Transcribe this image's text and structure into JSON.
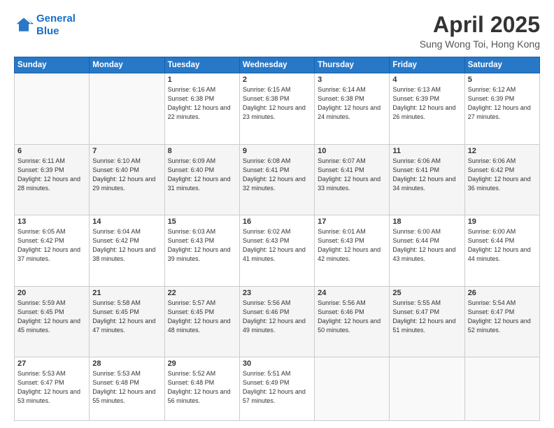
{
  "header": {
    "logo_line1": "General",
    "logo_line2": "Blue",
    "month": "April 2025",
    "location": "Sung Wong Toi, Hong Kong"
  },
  "weekdays": [
    "Sunday",
    "Monday",
    "Tuesday",
    "Wednesday",
    "Thursday",
    "Friday",
    "Saturday"
  ],
  "weeks": [
    [
      {
        "day": "",
        "sunrise": "",
        "sunset": "",
        "daylight": ""
      },
      {
        "day": "",
        "sunrise": "",
        "sunset": "",
        "daylight": ""
      },
      {
        "day": "1",
        "sunrise": "Sunrise: 6:16 AM",
        "sunset": "Sunset: 6:38 PM",
        "daylight": "Daylight: 12 hours and 22 minutes."
      },
      {
        "day": "2",
        "sunrise": "Sunrise: 6:15 AM",
        "sunset": "Sunset: 6:38 PM",
        "daylight": "Daylight: 12 hours and 23 minutes."
      },
      {
        "day": "3",
        "sunrise": "Sunrise: 6:14 AM",
        "sunset": "Sunset: 6:38 PM",
        "daylight": "Daylight: 12 hours and 24 minutes."
      },
      {
        "day": "4",
        "sunrise": "Sunrise: 6:13 AM",
        "sunset": "Sunset: 6:39 PM",
        "daylight": "Daylight: 12 hours and 26 minutes."
      },
      {
        "day": "5",
        "sunrise": "Sunrise: 6:12 AM",
        "sunset": "Sunset: 6:39 PM",
        "daylight": "Daylight: 12 hours and 27 minutes."
      }
    ],
    [
      {
        "day": "6",
        "sunrise": "Sunrise: 6:11 AM",
        "sunset": "Sunset: 6:39 PM",
        "daylight": "Daylight: 12 hours and 28 minutes."
      },
      {
        "day": "7",
        "sunrise": "Sunrise: 6:10 AM",
        "sunset": "Sunset: 6:40 PM",
        "daylight": "Daylight: 12 hours and 29 minutes."
      },
      {
        "day": "8",
        "sunrise": "Sunrise: 6:09 AM",
        "sunset": "Sunset: 6:40 PM",
        "daylight": "Daylight: 12 hours and 31 minutes."
      },
      {
        "day": "9",
        "sunrise": "Sunrise: 6:08 AM",
        "sunset": "Sunset: 6:41 PM",
        "daylight": "Daylight: 12 hours and 32 minutes."
      },
      {
        "day": "10",
        "sunrise": "Sunrise: 6:07 AM",
        "sunset": "Sunset: 6:41 PM",
        "daylight": "Daylight: 12 hours and 33 minutes."
      },
      {
        "day": "11",
        "sunrise": "Sunrise: 6:06 AM",
        "sunset": "Sunset: 6:41 PM",
        "daylight": "Daylight: 12 hours and 34 minutes."
      },
      {
        "day": "12",
        "sunrise": "Sunrise: 6:06 AM",
        "sunset": "Sunset: 6:42 PM",
        "daylight": "Daylight: 12 hours and 36 minutes."
      }
    ],
    [
      {
        "day": "13",
        "sunrise": "Sunrise: 6:05 AM",
        "sunset": "Sunset: 6:42 PM",
        "daylight": "Daylight: 12 hours and 37 minutes."
      },
      {
        "day": "14",
        "sunrise": "Sunrise: 6:04 AM",
        "sunset": "Sunset: 6:42 PM",
        "daylight": "Daylight: 12 hours and 38 minutes."
      },
      {
        "day": "15",
        "sunrise": "Sunrise: 6:03 AM",
        "sunset": "Sunset: 6:43 PM",
        "daylight": "Daylight: 12 hours and 39 minutes."
      },
      {
        "day": "16",
        "sunrise": "Sunrise: 6:02 AM",
        "sunset": "Sunset: 6:43 PM",
        "daylight": "Daylight: 12 hours and 41 minutes."
      },
      {
        "day": "17",
        "sunrise": "Sunrise: 6:01 AM",
        "sunset": "Sunset: 6:43 PM",
        "daylight": "Daylight: 12 hours and 42 minutes."
      },
      {
        "day": "18",
        "sunrise": "Sunrise: 6:00 AM",
        "sunset": "Sunset: 6:44 PM",
        "daylight": "Daylight: 12 hours and 43 minutes."
      },
      {
        "day": "19",
        "sunrise": "Sunrise: 6:00 AM",
        "sunset": "Sunset: 6:44 PM",
        "daylight": "Daylight: 12 hours and 44 minutes."
      }
    ],
    [
      {
        "day": "20",
        "sunrise": "Sunrise: 5:59 AM",
        "sunset": "Sunset: 6:45 PM",
        "daylight": "Daylight: 12 hours and 45 minutes."
      },
      {
        "day": "21",
        "sunrise": "Sunrise: 5:58 AM",
        "sunset": "Sunset: 6:45 PM",
        "daylight": "Daylight: 12 hours and 47 minutes."
      },
      {
        "day": "22",
        "sunrise": "Sunrise: 5:57 AM",
        "sunset": "Sunset: 6:45 PM",
        "daylight": "Daylight: 12 hours and 48 minutes."
      },
      {
        "day": "23",
        "sunrise": "Sunrise: 5:56 AM",
        "sunset": "Sunset: 6:46 PM",
        "daylight": "Daylight: 12 hours and 49 minutes."
      },
      {
        "day": "24",
        "sunrise": "Sunrise: 5:56 AM",
        "sunset": "Sunset: 6:46 PM",
        "daylight": "Daylight: 12 hours and 50 minutes."
      },
      {
        "day": "25",
        "sunrise": "Sunrise: 5:55 AM",
        "sunset": "Sunset: 6:47 PM",
        "daylight": "Daylight: 12 hours and 51 minutes."
      },
      {
        "day": "26",
        "sunrise": "Sunrise: 5:54 AM",
        "sunset": "Sunset: 6:47 PM",
        "daylight": "Daylight: 12 hours and 52 minutes."
      }
    ],
    [
      {
        "day": "27",
        "sunrise": "Sunrise: 5:53 AM",
        "sunset": "Sunset: 6:47 PM",
        "daylight": "Daylight: 12 hours and 53 minutes."
      },
      {
        "day": "28",
        "sunrise": "Sunrise: 5:53 AM",
        "sunset": "Sunset: 6:48 PM",
        "daylight": "Daylight: 12 hours and 55 minutes."
      },
      {
        "day": "29",
        "sunrise": "Sunrise: 5:52 AM",
        "sunset": "Sunset: 6:48 PM",
        "daylight": "Daylight: 12 hours and 56 minutes."
      },
      {
        "day": "30",
        "sunrise": "Sunrise: 5:51 AM",
        "sunset": "Sunset: 6:49 PM",
        "daylight": "Daylight: 12 hours and 57 minutes."
      },
      {
        "day": "",
        "sunrise": "",
        "sunset": "",
        "daylight": ""
      },
      {
        "day": "",
        "sunrise": "",
        "sunset": "",
        "daylight": ""
      },
      {
        "day": "",
        "sunrise": "",
        "sunset": "",
        "daylight": ""
      }
    ]
  ]
}
